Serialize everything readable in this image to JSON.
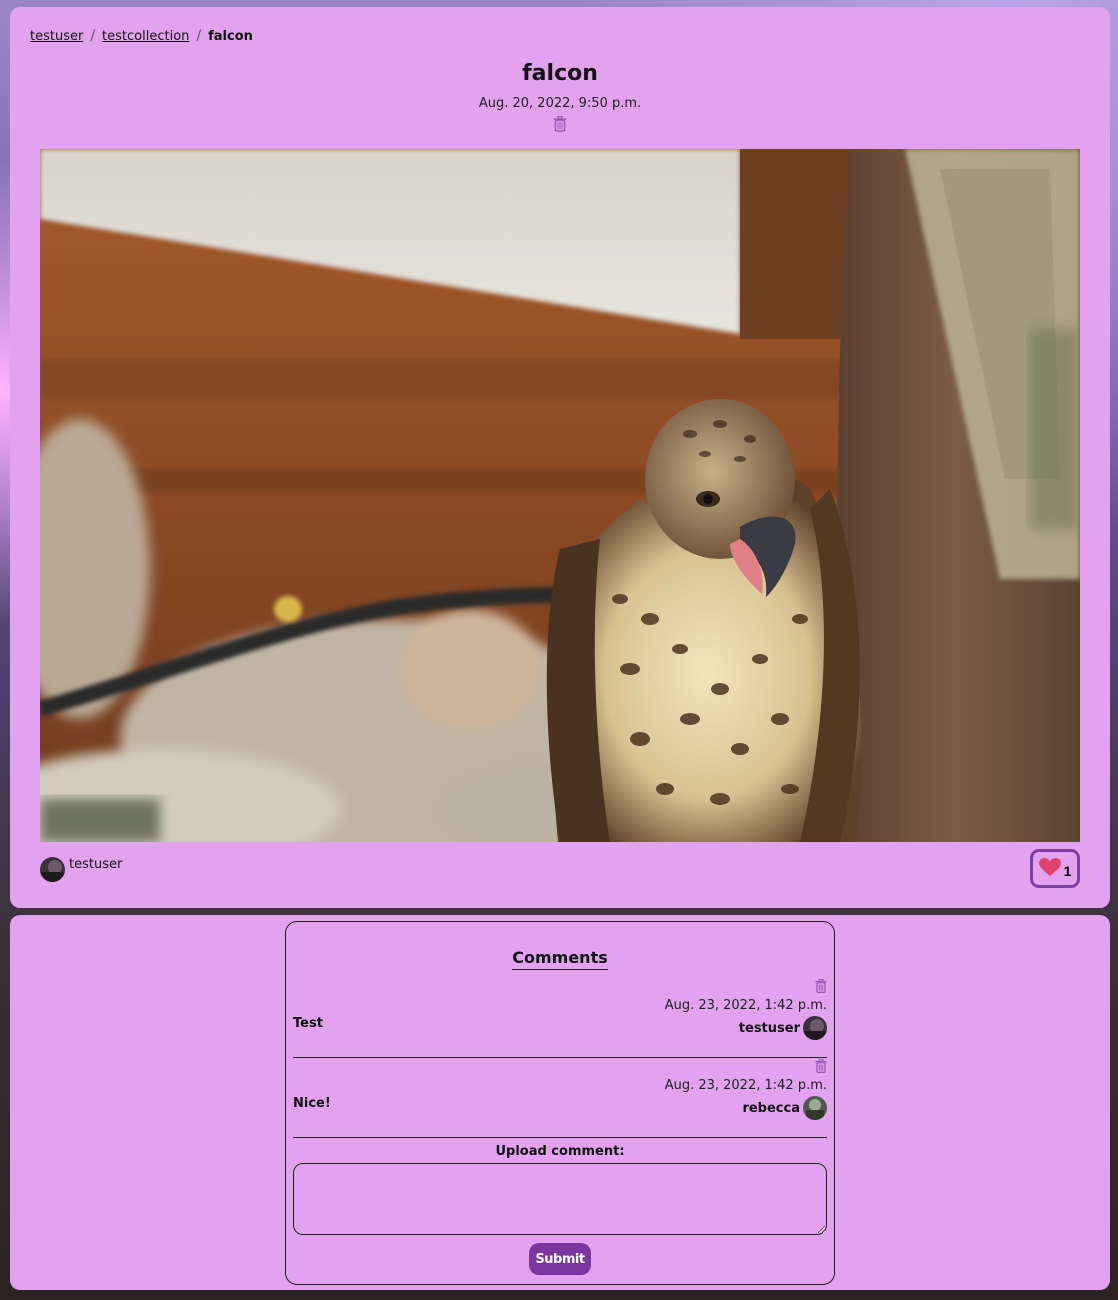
{
  "breadcrumb": {
    "user": "testuser",
    "separator_1": "/",
    "collection": "testcollection",
    "separator_2": "/",
    "current": "falcon"
  },
  "post": {
    "title": "falcon",
    "date": "Aug. 20, 2022, 9:50 p.m.",
    "image_description_icon": "falcon-photo",
    "author": "testuser",
    "like_count": "1",
    "like_icon": "heart-icon",
    "delete_icon": "trash-icon"
  },
  "comments_section": {
    "heading": "Comments",
    "comments": [
      {
        "text": "Test",
        "date": "Aug. 23, 2022, 1:42 p.m.",
        "user": "testuser"
      },
      {
        "text": "Nice!",
        "date": "Aug. 23, 2022, 1:42 p.m.",
        "user": "rebecca"
      }
    ],
    "upload_label": "Upload comment:",
    "input_placeholder": "",
    "submit_label": "Submit"
  },
  "colors": {
    "card_background": "#e2a2f0",
    "accent": "#7b36a0",
    "like_border": "#7e3fa2",
    "heart": "#e0436b",
    "trash": "#9a5ab4"
  }
}
